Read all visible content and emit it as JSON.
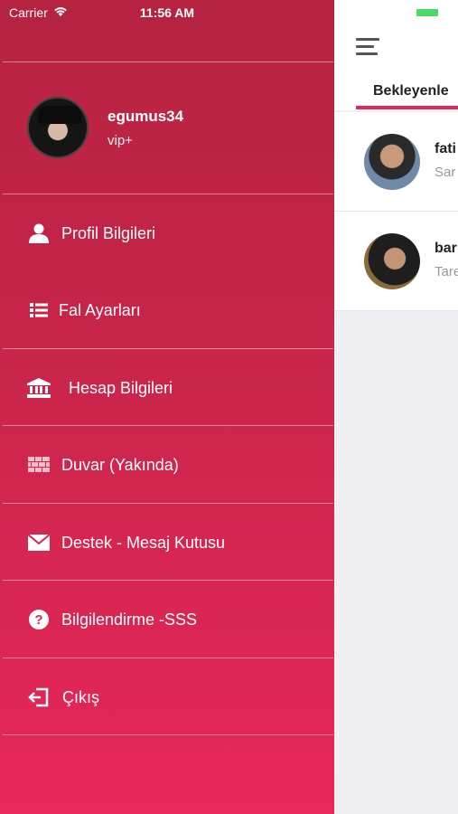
{
  "status_bar": {
    "carrier": "Carrier",
    "time": "11:56 AM"
  },
  "profile": {
    "username": "egumus34",
    "level": "vip+"
  },
  "menu": [
    {
      "label": "Profil Bilgileri",
      "icon": "person-icon"
    },
    {
      "label": "Fal Ayarları",
      "icon": "list-icon"
    },
    {
      "label": "Hesap Bilgileri",
      "icon": "bank-icon"
    },
    {
      "label": "Duvar (Yakında)",
      "icon": "wall-icon"
    },
    {
      "label": "Destek - Mesaj Kutusu",
      "icon": "mail-icon"
    },
    {
      "label": "Bilgilendirme -SSS",
      "icon": "question-icon"
    },
    {
      "label": "Çıkış",
      "icon": "logout-icon"
    }
  ],
  "main": {
    "tab": "Bekleyenle",
    "rows": [
      {
        "name": "fati",
        "sub": "Sar"
      },
      {
        "name": "bar",
        "sub": "Tare"
      }
    ]
  },
  "colors": {
    "accent": "#e0295a",
    "drawer_top": "#b52340",
    "drawer_bottom": "#e8275a"
  }
}
